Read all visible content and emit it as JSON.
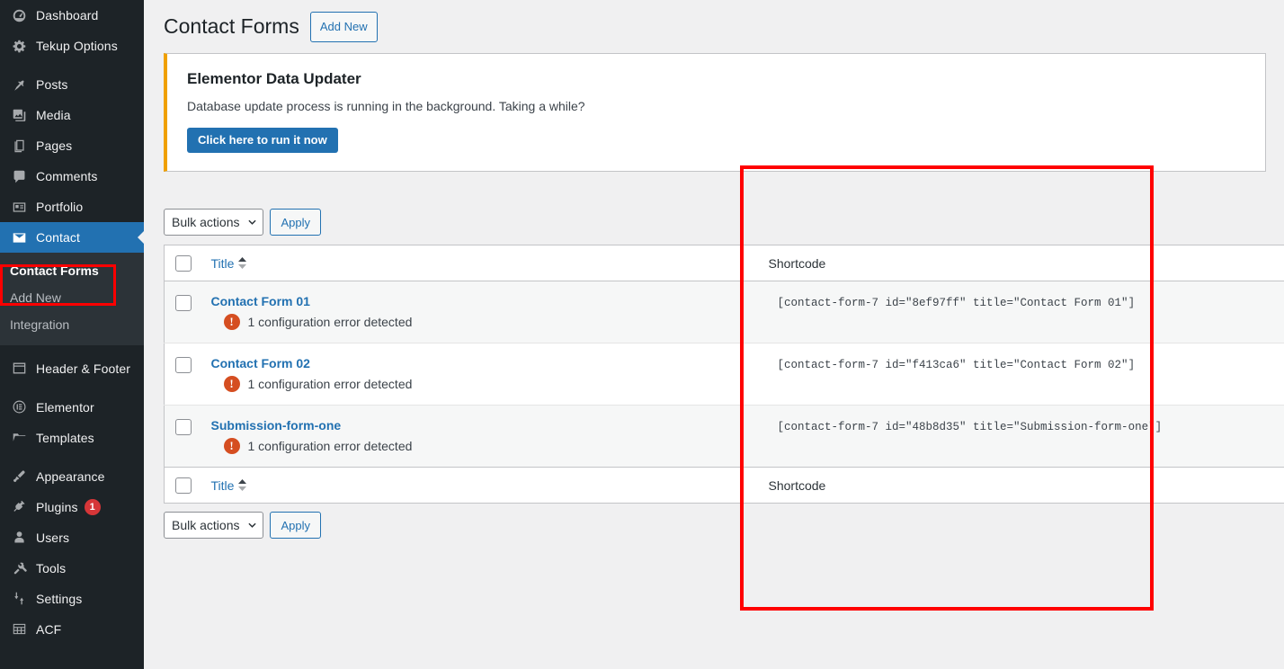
{
  "sidebar": {
    "items": [
      {
        "label": "Dashboard",
        "icon": "dashboard-gauge-icon",
        "name": "dashboard"
      },
      {
        "label": "Tekup Options",
        "icon": "gear-icon",
        "name": "tekup-options"
      },
      {
        "label": "Posts",
        "icon": "pin-icon",
        "name": "posts"
      },
      {
        "label": "Media",
        "icon": "media-icon",
        "name": "media"
      },
      {
        "label": "Pages",
        "icon": "pages-icon",
        "name": "pages"
      },
      {
        "label": "Comments",
        "icon": "comment-bubble-icon",
        "name": "comments"
      },
      {
        "label": "Portfolio",
        "icon": "portfolio-card-icon",
        "name": "portfolio"
      },
      {
        "label": "Contact",
        "icon": "envelope-icon",
        "name": "contact",
        "current": true
      },
      {
        "label": "Header & Footer",
        "icon": "layout-icon",
        "name": "header-footer"
      },
      {
        "label": "Elementor",
        "icon": "elementor-icon",
        "name": "elementor"
      },
      {
        "label": "Templates",
        "icon": "folder-icon",
        "name": "templates"
      },
      {
        "label": "Appearance",
        "icon": "paintbrush-icon",
        "name": "appearance"
      },
      {
        "label": "Plugins",
        "icon": "plug-icon",
        "name": "plugins",
        "badge": "1"
      },
      {
        "label": "Users",
        "icon": "user-icon",
        "name": "users"
      },
      {
        "label": "Tools",
        "icon": "wrench-icon",
        "name": "tools"
      },
      {
        "label": "Settings",
        "icon": "sliders-icon",
        "name": "settings"
      },
      {
        "label": "ACF",
        "icon": "grid-icon",
        "name": "acf"
      }
    ],
    "submenu": [
      {
        "label": "Contact Forms",
        "current": true
      },
      {
        "label": "Add New",
        "current": false
      },
      {
        "label": "Integration",
        "current": false
      }
    ],
    "highlight_color": "#ff0000"
  },
  "header": {
    "title": "Contact Forms",
    "add_new_label": "Add New"
  },
  "notice": {
    "title": "Elementor Data Updater",
    "description": "Database update process is running in the background. Taking a while?",
    "button_label": "Click here to run it now",
    "accent_color": "#f0a000",
    "button_color": "#2271b1"
  },
  "tablenav_top": {
    "bulk_actions_label": "Bulk actions",
    "apply_label": "Apply"
  },
  "tablenav_bottom": {
    "bulk_actions_label": "Bulk actions",
    "apply_label": "Apply"
  },
  "table": {
    "columns": {
      "title": "Title",
      "shortcode": "Shortcode"
    },
    "rows": [
      {
        "title": "Contact Form 01",
        "error": "1 configuration error detected",
        "shortcode": "[contact-form-7 id=\"8ef97ff\" title=\"Contact Form 01\"]"
      },
      {
        "title": "Contact Form 02",
        "error": "1 configuration error detected",
        "shortcode": "[contact-form-7 id=\"f413ca6\" title=\"Contact Form 02\"]"
      },
      {
        "title": "Submission-form-one",
        "error": "1 configuration error detected",
        "shortcode": "[contact-form-7 id=\"48b8d35\" title=\"Submission-form-one\"]"
      }
    ]
  },
  "annotations": {
    "shortcode_box_color": "#ff0000",
    "sidebar_box_color": "#ff0000"
  }
}
